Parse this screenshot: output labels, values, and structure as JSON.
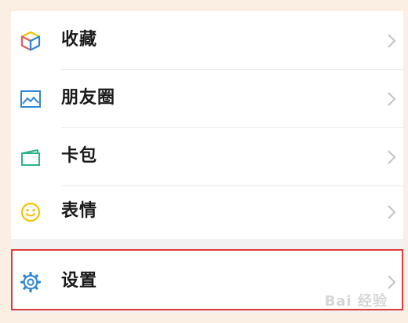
{
  "menu": {
    "items": [
      {
        "label": "收藏",
        "icon": "cube-icon"
      },
      {
        "label": "朋友圈",
        "icon": "picture-icon"
      },
      {
        "label": "卡包",
        "icon": "card-wallet-icon"
      },
      {
        "label": "表情",
        "icon": "smiley-icon"
      }
    ],
    "settings": {
      "label": "设置",
      "icon": "gear-icon"
    }
  },
  "watermark": "Bai 经验",
  "colors": {
    "background": "#fbeee3",
    "highlight_border": "#e03a3a",
    "icon_blue": "#2f86d6",
    "icon_yellow": "#f2c200",
    "icon_red": "#e85a5a",
    "icon_green": "#2bb38a"
  }
}
